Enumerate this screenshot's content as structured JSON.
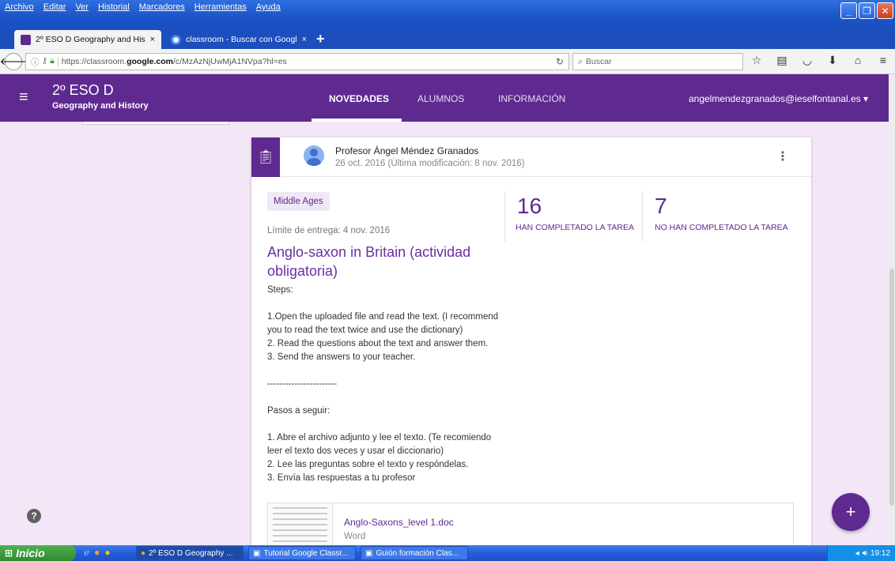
{
  "browser": {
    "menus": [
      "Archivo",
      "Editar",
      "Ver",
      "Historial",
      "Marcadores",
      "Herramientas",
      "Ayuda"
    ],
    "tabs": [
      {
        "title": "2º ESO D Geography and Hist...",
        "close": "×",
        "favicon_color": "#5e2a8f"
      },
      {
        "title": "classroom - Buscar con Google",
        "close": "×",
        "favicon_color": "#4285f4"
      }
    ],
    "new_tab": "+",
    "url_prefix": "https://classroom.",
    "url_domain": "google.com",
    "url_path": "/c/MzAzNjUwMjA1NVpa?hl=es",
    "search_placeholder": "Buscar"
  },
  "classroom": {
    "class_name": "2º ESO D",
    "subject": "Geography and History",
    "tabs": [
      "NOVEDADES",
      "ALUMNOS",
      "INFORMACIÓN"
    ],
    "account": "angelmendezgranados@ieselfontanal.es ▾"
  },
  "post": {
    "author": "Profesor Ángel Méndez Granados",
    "date": "26 oct. 2016 (Última modificación: 8 nov. 2016)",
    "topic": "Middle Ages",
    "due": "Límite de entrega: 4 nov. 2016",
    "title": "Anglo-saxon in Britain (actividad obligatoria)",
    "description": "Steps:\n\n1.Open the uploaded file and read the text. (I recommend you to read the text twice and use the dictionary)\n2. Read the questions about the text and answer them.\n3. Send the answers to your teacher.\n\n-----------------------\n\nPasos a seguir:\n\n1. Abre el archivo adjunto y lee el texto. (Te recomiendo leer el texto dos veces y usar el diccionario)\n2. Lee las preguntas sobre el texto y respóndelas.\n3. Envía las respuestas a tu profesor",
    "completed_count": "16",
    "completed_label": "HAN COMPLETADO LA TAREA",
    "not_completed_count": "7",
    "not_completed_label": "NO HAN COMPLETADO LA TAREA",
    "attachment": {
      "name": "Anglo-Saxons_level 1.doc",
      "type": "Word"
    }
  },
  "taskbar": {
    "start": "Inicio",
    "items": [
      "2º ESO D Geography ...",
      "Tutorial Google Classr...",
      "Guión formación Clas..."
    ],
    "clock": "19:12"
  },
  "colors": {
    "brand": "#5e2a8f",
    "background": "#f2e6f7",
    "xp_blue": "#245edb"
  }
}
